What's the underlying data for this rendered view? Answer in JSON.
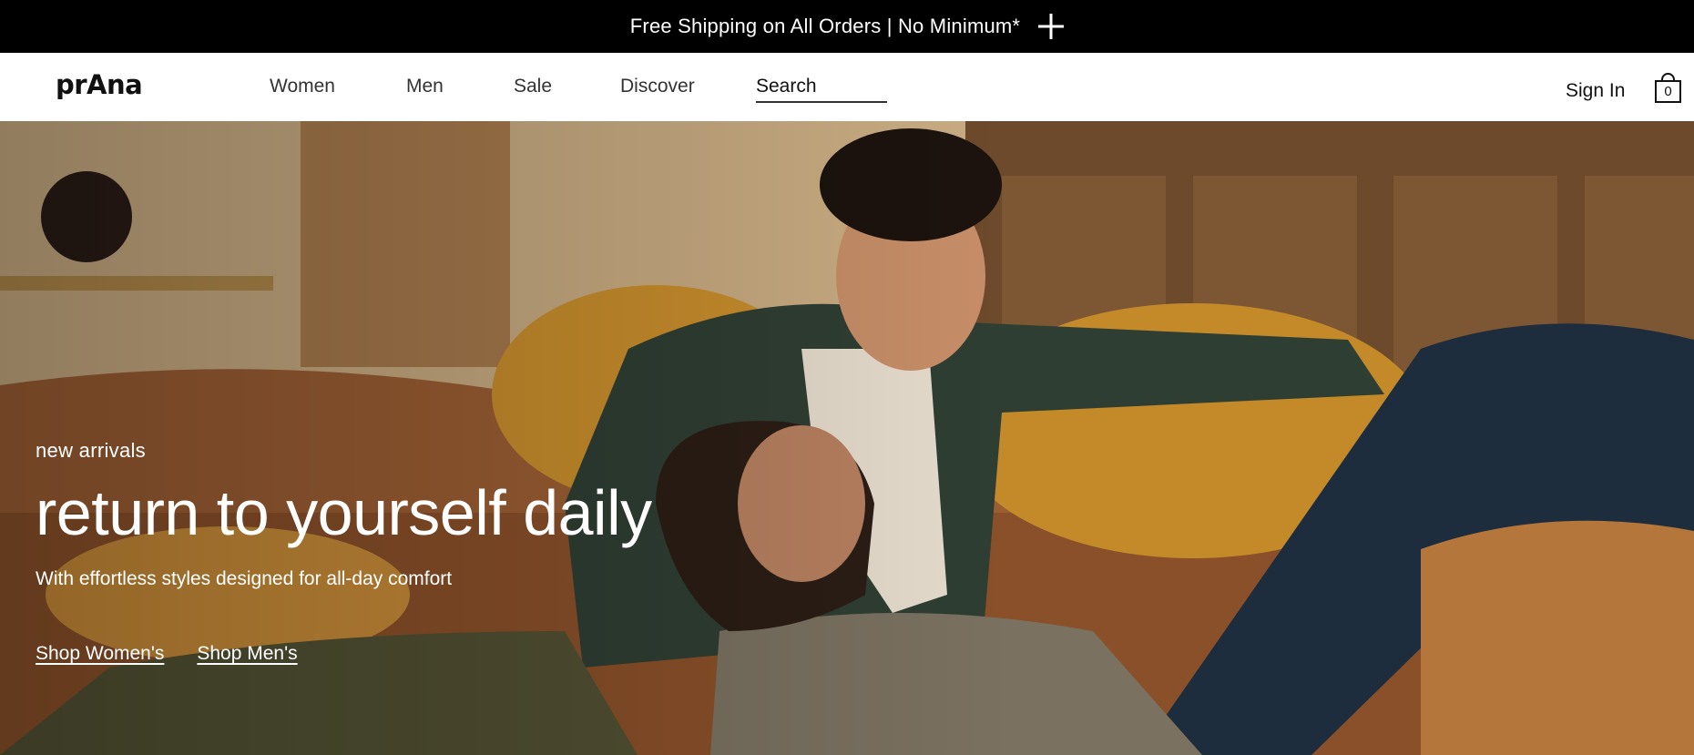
{
  "promo": {
    "text": "Free Shipping on All Orders | No Minimum*",
    "expand_icon": "plus-icon"
  },
  "header": {
    "logo": "prAna",
    "nav": [
      {
        "label": "Women"
      },
      {
        "label": "Men"
      },
      {
        "label": "Sale"
      },
      {
        "label": "Discover"
      }
    ],
    "search": {
      "label": "Search"
    },
    "sign_in": "Sign In",
    "cart": {
      "icon": "shopping-bag-icon",
      "count": "0"
    }
  },
  "hero": {
    "eyebrow": "new arrivals",
    "headline": "return to yourself daily",
    "subhead": "With effortless styles designed for all-day comfort",
    "ctas": [
      {
        "label": "Shop Women's"
      },
      {
        "label": "Shop Men's"
      }
    ]
  },
  "colors": {
    "promo_bg": "#000000",
    "text_dark": "#111111",
    "hero_text": "#ffffff"
  }
}
